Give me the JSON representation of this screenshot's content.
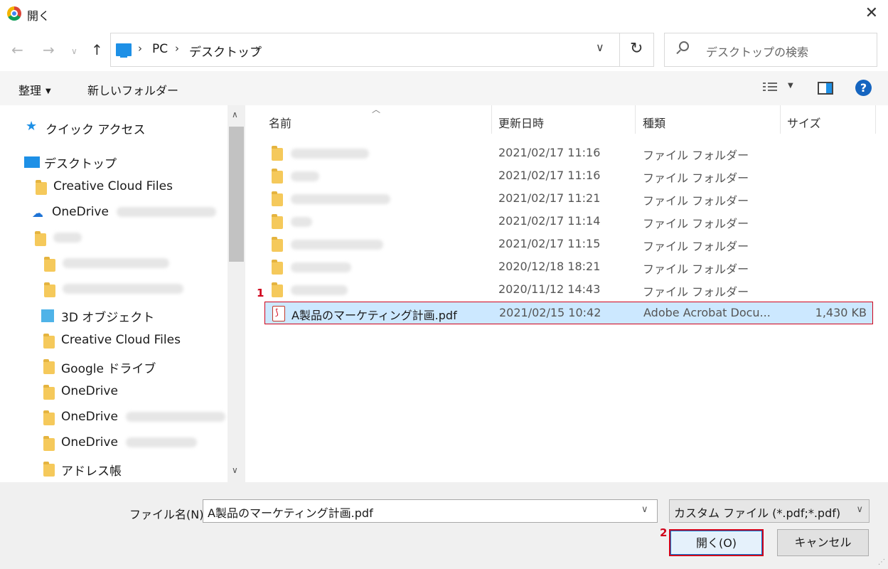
{
  "window": {
    "title": "開く"
  },
  "address": {
    "crumbs": [
      "PC",
      "デスクトップ"
    ]
  },
  "search": {
    "placeholder": "デスクトップの検索"
  },
  "toolbar": {
    "organize": "整理",
    "new_folder": "新しいフォルダー",
    "help": "?"
  },
  "nav": {
    "quick_access": "クイック アクセス",
    "desktop": "デスクトップ",
    "creative_cloud_top": "Creative Cloud Files",
    "onedrive_top": "OneDrive",
    "objects3d": "3D オブジェクト",
    "creative_cloud": "Creative Cloud Files",
    "google_drive": "Google ドライブ",
    "onedrive_1": "OneDrive",
    "onedrive_2": "OneDrive",
    "onedrive_3": "OneDrive",
    "address_book": "アドレス帳"
  },
  "columns": {
    "name": "名前",
    "date": "更新日時",
    "type": "種類",
    "size": "サイズ"
  },
  "files": [
    {
      "date": "2021/02/17 11:16",
      "type": "ファイル フォルダー"
    },
    {
      "date": "2021/02/17 11:16",
      "type": "ファイル フォルダー"
    },
    {
      "date": "2021/02/17 11:21",
      "type": "ファイル フォルダー"
    },
    {
      "date": "2021/02/17 11:14",
      "type": "ファイル フォルダー"
    },
    {
      "date": "2021/02/17 11:15",
      "type": "ファイル フォルダー"
    },
    {
      "date": "2020/12/18 18:21",
      "type": "ファイル フォルダー"
    },
    {
      "date": "2020/11/12 14:43",
      "type": "ファイル フォルダー"
    },
    {
      "name": "A製品のマーケティング計画.pdf",
      "date": "2021/02/15 10:42",
      "type": "Adobe Acrobat Docu...",
      "size": "1,430 KB"
    }
  ],
  "callouts": {
    "one": "1",
    "two": "2"
  },
  "footer": {
    "filename_label": "ファイル名(N):",
    "filename_value": "A製品のマーケティング計画.pdf",
    "filter": "カスタム ファイル (*.pdf;*.pdf)",
    "open": "開く(O)",
    "cancel": "キャンセル"
  },
  "colors": {
    "accent": "#0078d7",
    "selection": "#cce8ff",
    "callout": "#d0021b"
  }
}
